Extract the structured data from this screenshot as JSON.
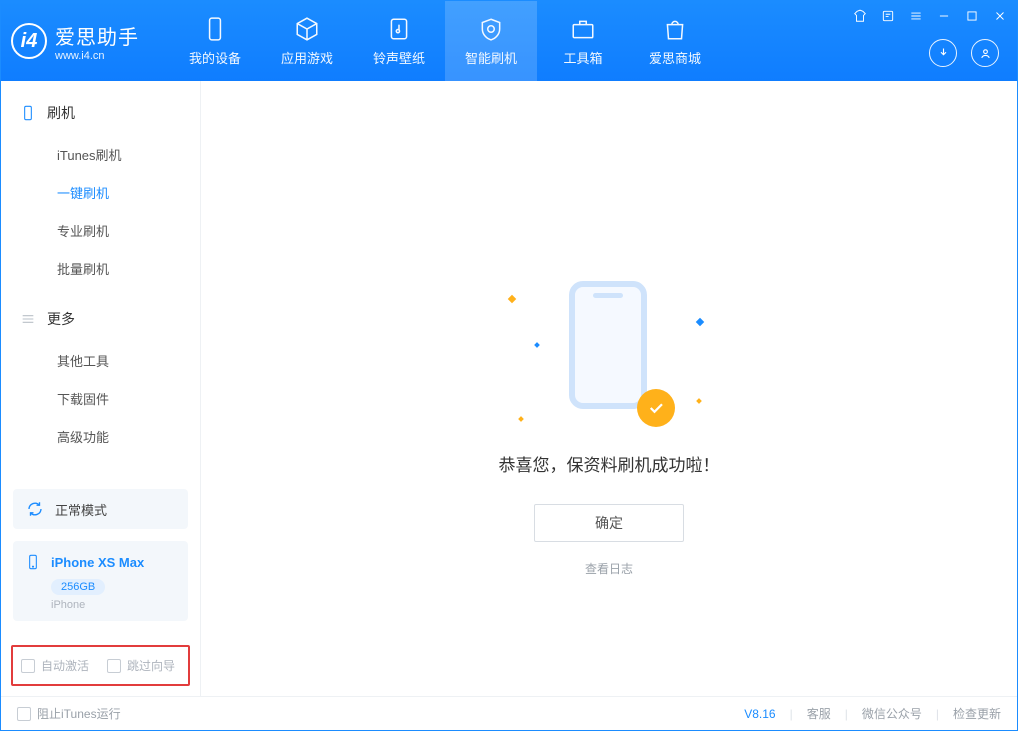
{
  "app": {
    "title": "爱思助手",
    "site": "www.i4.cn"
  },
  "tabs": {
    "device": "我的设备",
    "apps": "应用游戏",
    "ring": "铃声壁纸",
    "flash": "智能刷机",
    "toolbox": "工具箱",
    "store": "爱思商城"
  },
  "sidebar": {
    "flash_head": "刷机",
    "items": {
      "itunes": "iTunes刷机",
      "onekey": "一键刷机",
      "pro": "专业刷机",
      "batch": "批量刷机"
    },
    "more_head": "更多",
    "more": {
      "tools": "其他工具",
      "firmware": "下载固件",
      "advanced": "高级功能"
    },
    "mode_label": "正常模式",
    "device": {
      "name": "iPhone XS Max",
      "capacity": "256GB",
      "type": "iPhone"
    },
    "options": {
      "auto_activate": "自动激活",
      "skip_guide": "跳过向导"
    }
  },
  "main": {
    "success": "恭喜您，保资料刷机成功啦！",
    "ok": "确定",
    "view_log": "查看日志"
  },
  "footer": {
    "block_itunes": "阻止iTunes运行",
    "version": "V8.16",
    "service": "客服",
    "wechat": "微信公众号",
    "update": "检查更新"
  }
}
